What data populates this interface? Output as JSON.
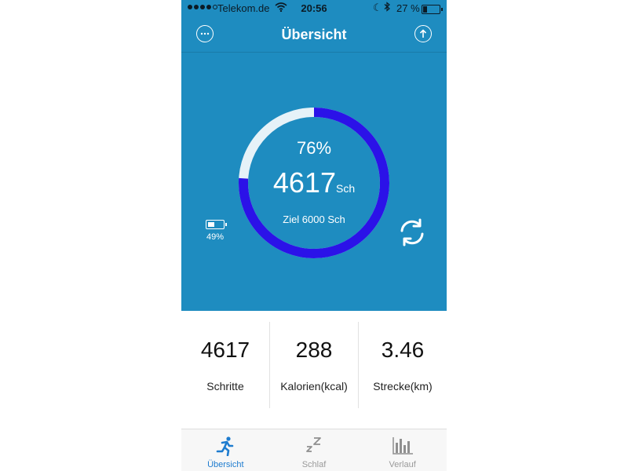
{
  "statusbar": {
    "carrier": "Telekom.de",
    "time": "20:56",
    "battery_percent": "27 %",
    "battery_level": 0.27
  },
  "navbar": {
    "title": "Übersicht"
  },
  "progress": {
    "percent_label": "76%",
    "fraction": 0.76,
    "steps": "4617",
    "steps_unit": "Sch",
    "goal_label": "Ziel 6000 Sch"
  },
  "device_battery": {
    "percent_label": "49%",
    "level": 0.49
  },
  "stats": [
    {
      "value": "4617",
      "label": "Schritte"
    },
    {
      "value": "288",
      "label": "Kalorien(kcal)"
    },
    {
      "value": "3.46",
      "label": "Strecke(km)"
    }
  ],
  "tabs": [
    {
      "label": "Übersicht",
      "icon": "running-person-icon",
      "active": true
    },
    {
      "label": "Schlaf",
      "icon": "sleep-zz-icon",
      "active": false
    },
    {
      "label": "Verlauf",
      "icon": "bar-chart-icon",
      "active": false
    }
  ],
  "colors": {
    "hero_bg": "#1e8cc0",
    "ring_progress": "#2b12e8",
    "ring_track": "#e6f2f8",
    "tab_active": "#1e7ccf"
  }
}
